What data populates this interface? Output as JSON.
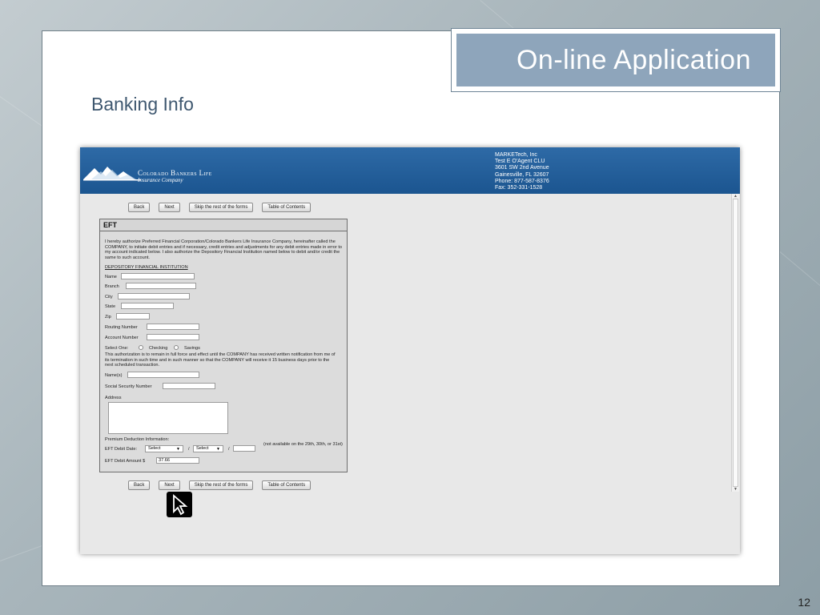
{
  "slide": {
    "title": "On-line Application",
    "subtitle": "Banking Info",
    "page_number": "12"
  },
  "screenshot": {
    "company": {
      "name": "Colorado Bankers Life",
      "tagline": "Insurance Company"
    },
    "agent_info": [
      "MARKETech, Inc",
      "Test E O'Agent CLU",
      "3601 SW 2nd Avenue",
      "Gainesville, FL 32607",
      "Phone: 877-587-8376",
      "Fax: 352-331-1528"
    ],
    "nav_buttons": {
      "back": "Back",
      "next": "Next",
      "skip": "Skip the rest of the forms",
      "toc": "Table of Contents"
    },
    "form": {
      "title": "EFT",
      "authorization_text": "I hereby authorize Preferred Financial Corporation/Colorado Bankers Life Insurance Company, hereinafter called the COMPANY, to initiate debit entries and if necessary, credit entries and adjustments for any debit entries made in error to my account indicated below. I also authorize the Depository Financial Institution named below to debit and/or credit the same to such account.",
      "section_heading": "DEPOSITORY FINANCIAL INSTITUTION",
      "labels": {
        "name": "Name",
        "branch": "Branch",
        "city": "City",
        "state": "State",
        "zip": "Zip",
        "routing": "Routing Number",
        "account": "Account Number",
        "select_one": "Select One:",
        "checking": "Checking",
        "savings": "Savings",
        "names": "Name(s)",
        "ssn": "Social Security Number",
        "address": "Address",
        "premium": "Premium Deduction Information:",
        "eft_date": "EFT Debit Date:",
        "eft_amount": "EFT Debit Amount $"
      },
      "authorization_continuation": "This authorization is to remain in full force and effect until the COMPANY has received written notification from me of its termination in such time and in such manner so that the COMPANY will receive it 15 business days prior to the next scheduled transaction.",
      "date_select_1": "Select",
      "date_select_2": "Select",
      "date_separator": "/",
      "date_note": "(not available on the 29th, 30th, or 31st)",
      "eft_amount_value": "37.66"
    }
  },
  "icons": {
    "cursor": "pointer-arrow-icon",
    "logo": "mountain-logo-icon"
  },
  "colors": {
    "header_blue": "#1b5590",
    "title_box": "#8ea5bb"
  }
}
